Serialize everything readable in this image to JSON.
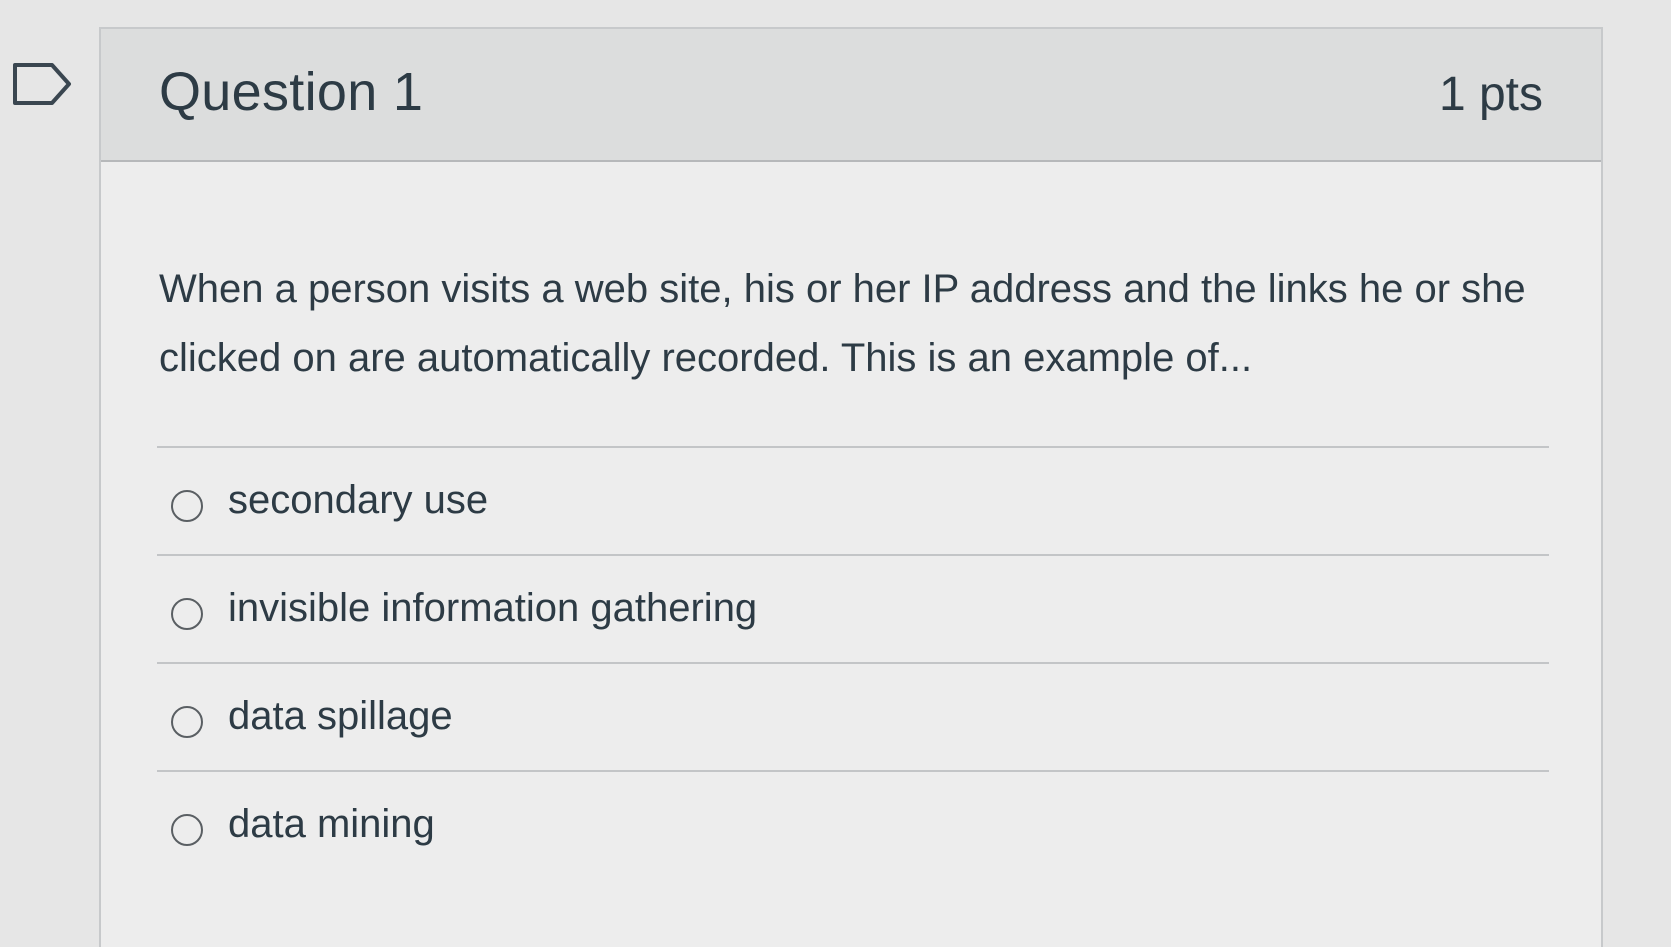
{
  "question": {
    "title": "Question 1",
    "points": "1 pts",
    "text": "When a person visits a web site, his or her IP address and the links he or she clicked on are automatically recorded.  This is an example of...",
    "flag_icon": "bookmark-flag-icon"
  },
  "answers": [
    {
      "label": "secondary use",
      "selected": false
    },
    {
      "label": "invisible information gathering",
      "selected": false
    },
    {
      "label": "data spillage",
      "selected": false
    },
    {
      "label": "data mining",
      "selected": false
    }
  ],
  "colors": {
    "text": "#2d3b45",
    "header_bg": "#dcdddd",
    "card_bg": "#ededed",
    "border": "#c7c9cb"
  }
}
